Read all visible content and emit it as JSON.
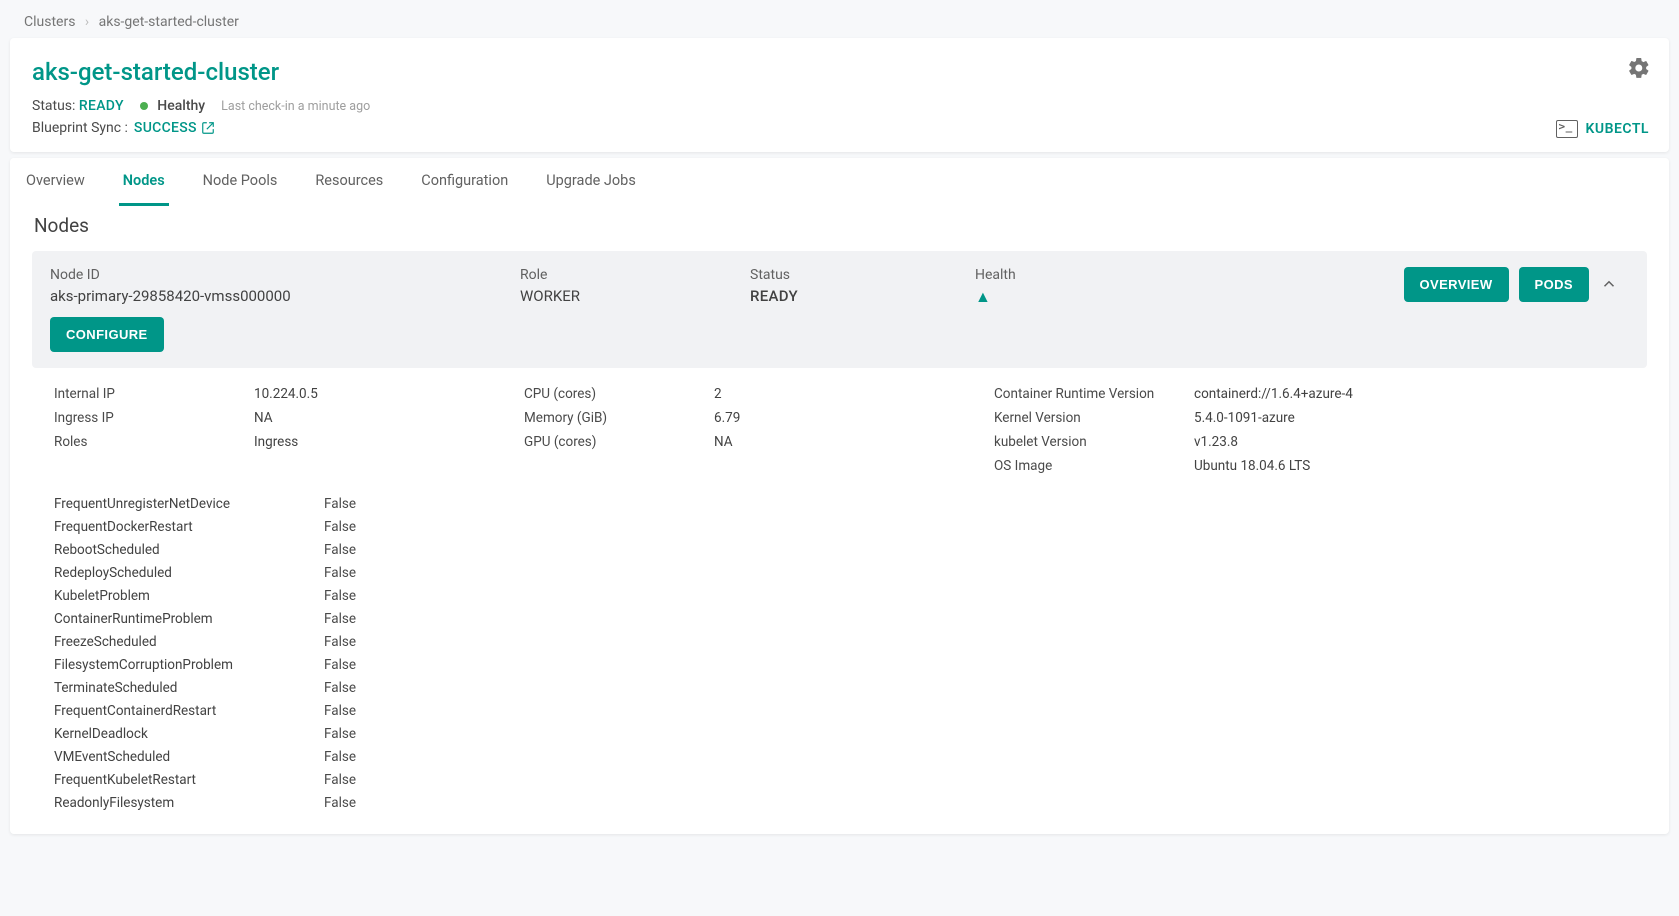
{
  "breadcrumb": {
    "root": "Clusters",
    "current": "aks-get-started-cluster"
  },
  "header": {
    "title": "aks-get-started-cluster",
    "status_label": "Status:",
    "status_value": "READY",
    "health_text": "Healthy",
    "checkin_text": "Last check-in a minute ago",
    "blueprint_label": "Blueprint Sync :",
    "blueprint_value": "SUCCESS",
    "kubectl": "KUBECTL"
  },
  "tabs": [
    {
      "label": "Overview",
      "active": false
    },
    {
      "label": "Nodes",
      "active": true
    },
    {
      "label": "Node Pools",
      "active": false
    },
    {
      "label": "Resources",
      "active": false
    },
    {
      "label": "Configuration",
      "active": false
    },
    {
      "label": "Upgrade Jobs",
      "active": false
    }
  ],
  "section_title": "Nodes",
  "node": {
    "labels": {
      "id": "Node ID",
      "role": "Role",
      "status": "Status",
      "health": "Health"
    },
    "id": "aks-primary-29858420-vmss000000",
    "role": "WORKER",
    "status": "READY",
    "buttons": {
      "overview": "OVERVIEW",
      "pods": "PODS",
      "configure": "CONFIGURE"
    }
  },
  "specs": {
    "col1": [
      {
        "k": "Internal IP",
        "v": "10.224.0.5"
      },
      {
        "k": "Ingress IP",
        "v": "NA"
      },
      {
        "k": "Roles",
        "v": "Ingress"
      }
    ],
    "col2": [
      {
        "k": "CPU (cores)",
        "v": "2"
      },
      {
        "k": "Memory (GiB)",
        "v": "6.79"
      },
      {
        "k": "GPU (cores)",
        "v": "NA"
      }
    ],
    "col3": [
      {
        "k": "Container Runtime Version",
        "v": "containerd://1.6.4+azure-4"
      },
      {
        "k": "Kernel Version",
        "v": "5.4.0-1091-azure"
      },
      {
        "k": "kubelet Version",
        "v": "v1.23.8"
      },
      {
        "k": "OS Image",
        "v": "Ubuntu 18.04.6 LTS"
      }
    ]
  },
  "conditions": [
    {
      "k": "FrequentUnregisterNetDevice",
      "v": "False"
    },
    {
      "k": "FrequentDockerRestart",
      "v": "False"
    },
    {
      "k": "RebootScheduled",
      "v": "False"
    },
    {
      "k": "RedeployScheduled",
      "v": "False"
    },
    {
      "k": "KubeletProblem",
      "v": "False"
    },
    {
      "k": "ContainerRuntimeProblem",
      "v": "False"
    },
    {
      "k": "FreezeScheduled",
      "v": "False"
    },
    {
      "k": "FilesystemCorruptionProblem",
      "v": "False"
    },
    {
      "k": "TerminateScheduled",
      "v": "False"
    },
    {
      "k": "FrequentContainerdRestart",
      "v": "False"
    },
    {
      "k": "KernelDeadlock",
      "v": "False"
    },
    {
      "k": "VMEventScheduled",
      "v": "False"
    },
    {
      "k": "FrequentKubeletRestart",
      "v": "False"
    },
    {
      "k": "ReadonlyFilesystem",
      "v": "False"
    }
  ]
}
